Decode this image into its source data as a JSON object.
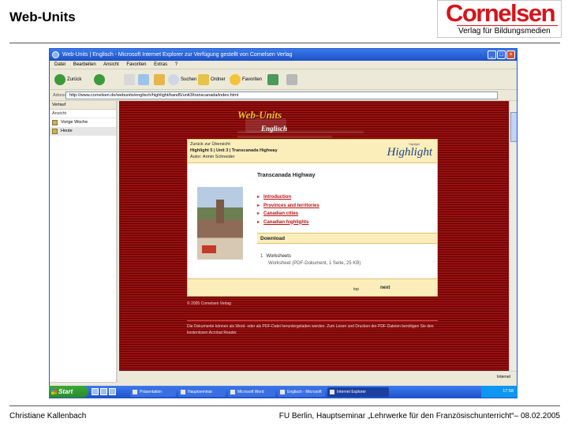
{
  "slide": {
    "title": "Web-Units",
    "logo_word": "Cornelsen",
    "logo_sub": "Verlag für Bildungsmedien",
    "footer_left": "Christiane Kallenbach",
    "footer_right": "FU Berlin, Hauptseminar „Lehrwerke für den Französischunterricht“– 08.02.2005"
  },
  "browser": {
    "title": "Web-Units | Englisch - Microsoft Internet Explorer zur Verfügung gestellt von Cornelsen Verlag",
    "menu": [
      "Datei",
      "Bearbeiten",
      "Ansicht",
      "Favoriten",
      "Extras",
      "?"
    ],
    "toolbar": {
      "back": "Zurück",
      "search": "Suchen",
      "history": "Ordner",
      "favorites": "Favoriten"
    },
    "address_label": "Adresse",
    "address": "http://www.cornelsen.de/webunits/englisch/highlight/band5/unit3/transcanada/index.html",
    "sidebar": {
      "header": "Verlauf",
      "subheader": "Ansicht",
      "items": [
        {
          "label": "Vorige Woche",
          "selected": false
        },
        {
          "label": "Heute",
          "selected": true
        }
      ]
    },
    "status_right": "Internet",
    "page": {
      "logo_title": "Web-Units",
      "logo_subject": "Englisch",
      "nav_line": "Zurück zur Übersicht",
      "path_line": "Highlight 5 | Unit 3 | Transcanada Highway",
      "author_line": "Autor: Armin Schneider",
      "brand_small": "Highlight",
      "brand": "Highlight",
      "unit_title": "Transcanada Highway",
      "links": [
        "Introduction",
        "Provinces and territories",
        "Canadian cities",
        "Canadian highlights"
      ],
      "download_label": "Download",
      "worksheets_label": "Worksheets",
      "worksheet_item": "Worksheet (PDF-Dokument, 1 Seite, 25 KB)",
      "foot_left": "top",
      "foot_next": "next",
      "copyright": "© 2005 Cornelsen Verlag",
      "note": "Die Dokumente können als Word- oder als PDF-Datei heruntergeladen werden. Zum Lesen und Drucken der PDF-Dateien benötigen Sie den kostenlosen Acrobat Reader."
    },
    "taskbar": {
      "start": "Start",
      "tasks": [
        "Präsentation",
        "Hauptseminar",
        "Microsoft Word",
        "Englisch - Microsoft",
        "Internet Explorer"
      ],
      "active_index": 4,
      "tray_time": "17:58"
    }
  }
}
